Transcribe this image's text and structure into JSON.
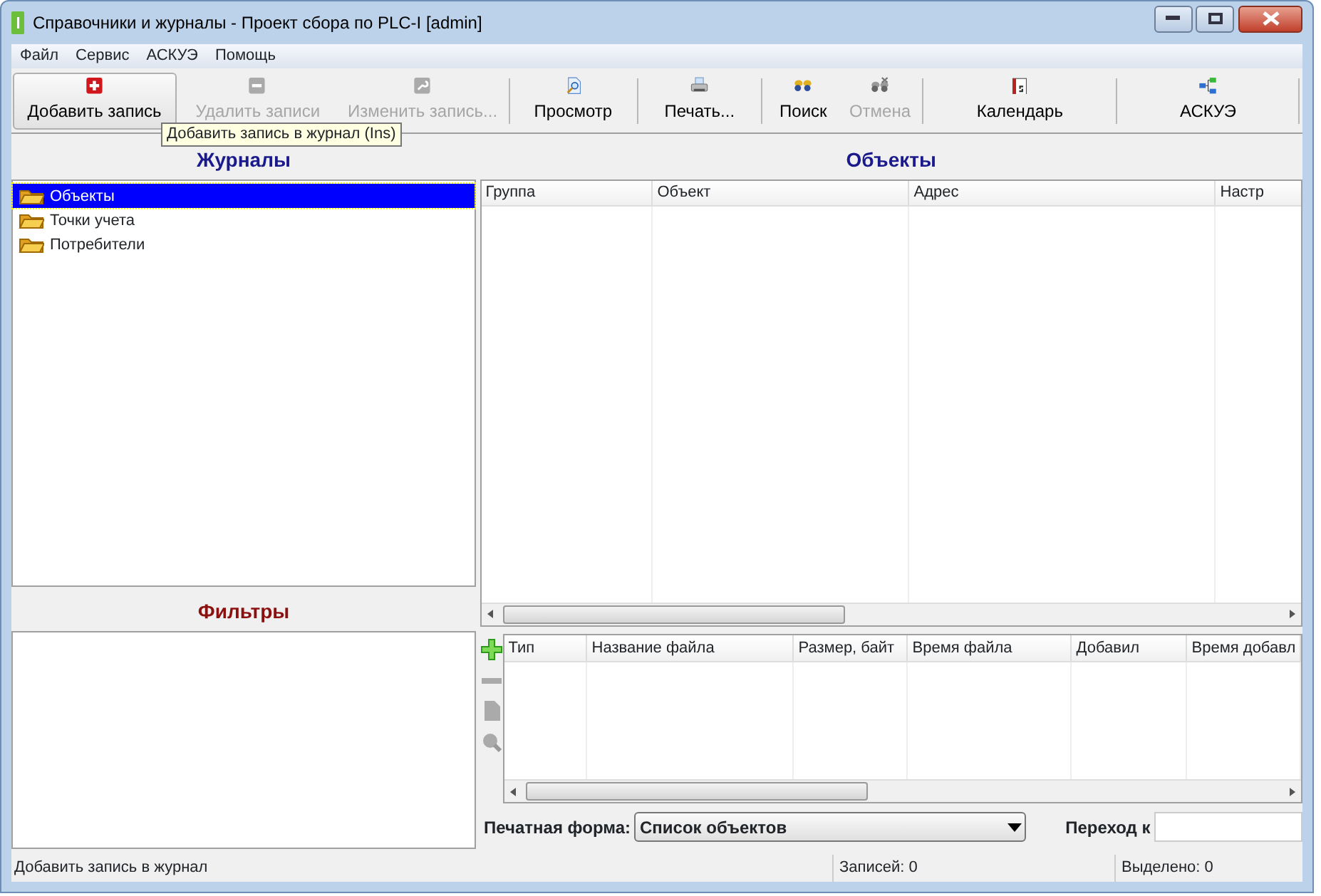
{
  "window": {
    "title": "Справочники и журналы - Проект сбора по PLC-I  [admin]"
  },
  "menu": [
    "Файл",
    "Сервис",
    "АСКУЭ",
    "Помощь"
  ],
  "toolbar": [
    {
      "label": "Добавить запись",
      "disabled": false,
      "hovered": true
    },
    {
      "label": "Удалить записи",
      "disabled": true,
      "hovered": false
    },
    {
      "label": "Изменить запись...",
      "disabled": true,
      "hovered": false
    },
    {
      "label": "Просмотр",
      "disabled": false,
      "hovered": false
    },
    {
      "label": "Печать...",
      "disabled": false,
      "hovered": false
    },
    {
      "label": "Поиск",
      "disabled": false,
      "hovered": false
    },
    {
      "label": "Отмена",
      "disabled": true,
      "hovered": false
    },
    {
      "label": "Календарь",
      "disabled": false,
      "hovered": false
    },
    {
      "label": "АСКУЭ",
      "disabled": false,
      "hovered": false
    }
  ],
  "tooltip": "Добавить запись в журнал (Ins)",
  "journals": {
    "title": "Журналы",
    "items": [
      {
        "label": "Объекты",
        "selected": true
      },
      {
        "label": "Точки учета",
        "selected": false
      },
      {
        "label": "Потребители",
        "selected": false
      }
    ]
  },
  "filters": {
    "title": "Фильтры"
  },
  "objects": {
    "title": "Объекты",
    "columns": [
      "Группа",
      "Объект",
      "Адрес",
      "Настр"
    ]
  },
  "files": {
    "tools": [
      {
        "disabled": false
      },
      {
        "disabled": true
      },
      {
        "disabled": true
      },
      {
        "disabled": true
      }
    ],
    "columns": [
      "Тип",
      "Название файла",
      "Размер, байт",
      "Время файла",
      "Добавил",
      "Время добавл"
    ]
  },
  "print_form": {
    "label": "Печатная форма:",
    "value": "Список объектов"
  },
  "goto": {
    "label": "Переход к"
  },
  "status_bar": [
    "Добавить запись в журнал",
    "Записей: 0",
    "Выделено: 0"
  ]
}
